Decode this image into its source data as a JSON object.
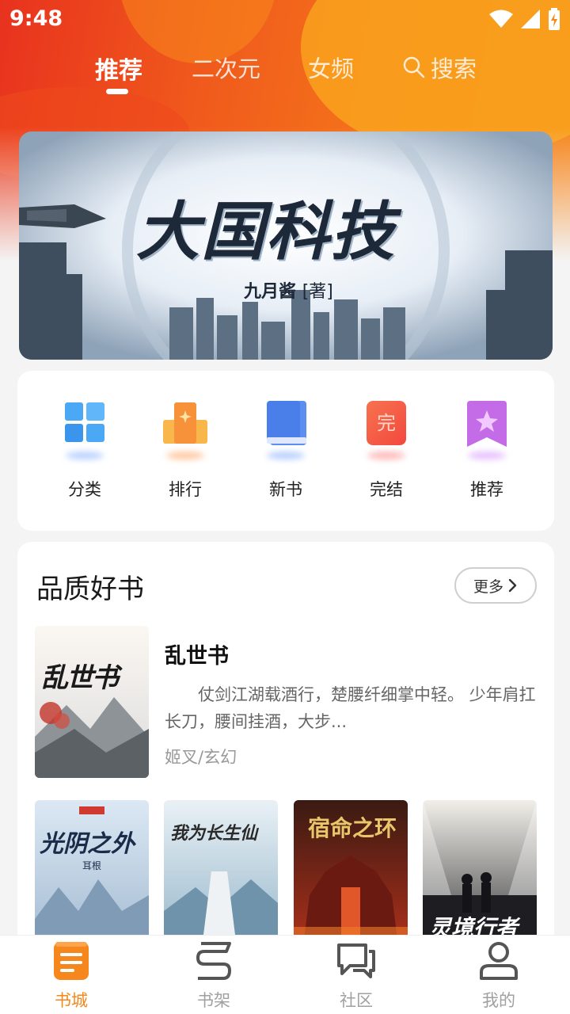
{
  "status_bar": {
    "time": "9:48"
  },
  "top_tabs": [
    {
      "label": "推荐",
      "active": true
    },
    {
      "label": "二次元",
      "active": false
    },
    {
      "label": "女频",
      "active": false
    },
    {
      "label": "搜索",
      "active": false,
      "icon": "search-icon"
    }
  ],
  "banner": {
    "title": "大国科技",
    "author": "九月酱",
    "author_tag": "[著]"
  },
  "quick_links": [
    {
      "label": "分类",
      "icon": "grid-icon"
    },
    {
      "label": "排行",
      "icon": "ranking-icon"
    },
    {
      "label": "新书",
      "icon": "book-icon"
    },
    {
      "label": "完结",
      "icon": "completed-icon",
      "icon_text": "完"
    },
    {
      "label": "推荐",
      "icon": "bookmark-star-icon"
    }
  ],
  "section": {
    "title": "品质好书",
    "more_label": "更多",
    "featured": {
      "title": "乱世书",
      "cover_text": "乱世书",
      "description": "仗剑江湖载酒行，楚腰纤细掌中轻。 少年肩扛长刀，腰间挂酒，大步...",
      "meta": "姬叉/玄幻"
    },
    "books": [
      {
        "cover_text": "光阴之外",
        "sub_text": "耳根"
      },
      {
        "cover_text": "我为长生仙",
        "sub_text": ""
      },
      {
        "cover_text": "宿命之环",
        "sub_text": ""
      },
      {
        "cover_text": "灵境行者",
        "sub_text": ""
      }
    ]
  },
  "bottom_nav": [
    {
      "label": "书城",
      "active": true
    },
    {
      "label": "书架",
      "active": false
    },
    {
      "label": "社区",
      "active": false
    },
    {
      "label": "我的",
      "active": false
    }
  ],
  "colors": {
    "accent": "#f5871c",
    "header_red": "#e8321e",
    "header_orange": "#f7861a"
  }
}
